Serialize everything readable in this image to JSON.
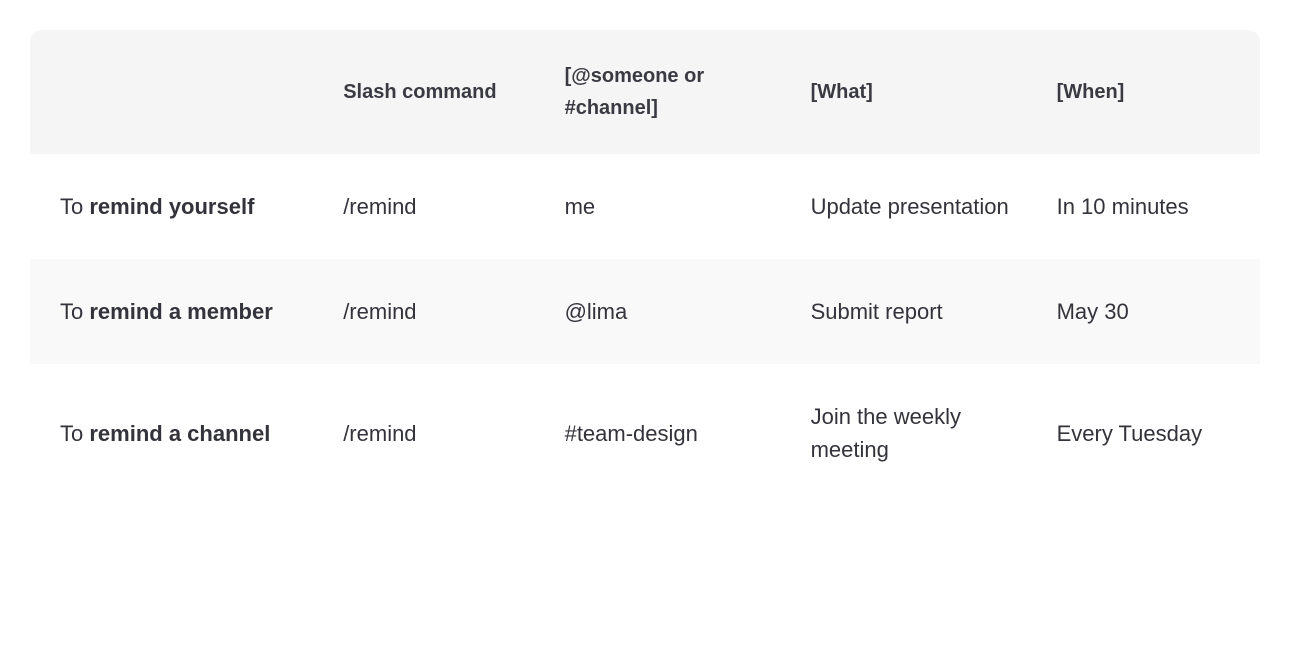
{
  "table": {
    "headers": {
      "col0": "",
      "col1": "Slash command",
      "col2": "[@someone or #channel]",
      "col3": "[What]",
      "col4": "[When]"
    },
    "rows": [
      {
        "desc_prefix": "To ",
        "desc_bold": "remind yourself",
        "command": "/remind",
        "target": "me",
        "what": "Update presentation",
        "when": "In 10 minutes"
      },
      {
        "desc_prefix": "To ",
        "desc_bold": "remind a member",
        "command": "/remind",
        "target": "@lima",
        "what": "Submit report",
        "when": "May 30"
      },
      {
        "desc_prefix": "To ",
        "desc_bold": "remind a channel",
        "command": "/remind",
        "target": "#team-design",
        "what": "Join the weekly meeting",
        "when": "Every Tuesday"
      }
    ]
  }
}
